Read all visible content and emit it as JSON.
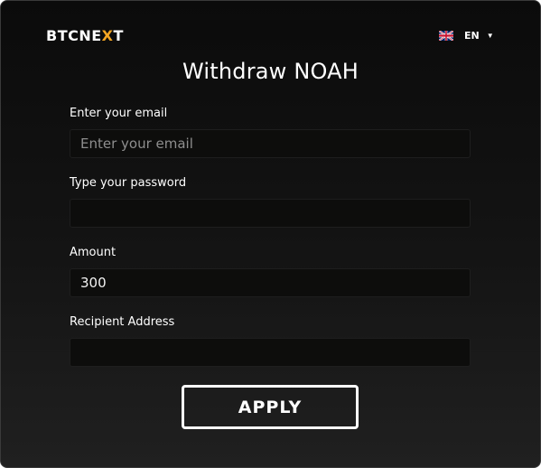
{
  "brand": {
    "logo_prefix": "BTCNE",
    "logo_accent": "X",
    "logo_suffix": "T",
    "accent_color": "#f5a623"
  },
  "language": {
    "flag_icon": "uk-flag-icon",
    "code": "EN",
    "caret": "▼"
  },
  "page": {
    "title": "Withdraw NOAH"
  },
  "form": {
    "email": {
      "label": "Enter your email",
      "placeholder": "Enter your email",
      "value": ""
    },
    "password": {
      "label": "Type your password",
      "value": ""
    },
    "amount": {
      "label": "Amount",
      "value": "300"
    },
    "recipient": {
      "label": "Recipient Address",
      "value": ""
    },
    "submit_label": "APPLY"
  },
  "colors": {
    "background_top": "#0b0b0b",
    "background_bottom": "#202020",
    "input_bg": "#0d0d0c",
    "text": "#ffffff"
  }
}
